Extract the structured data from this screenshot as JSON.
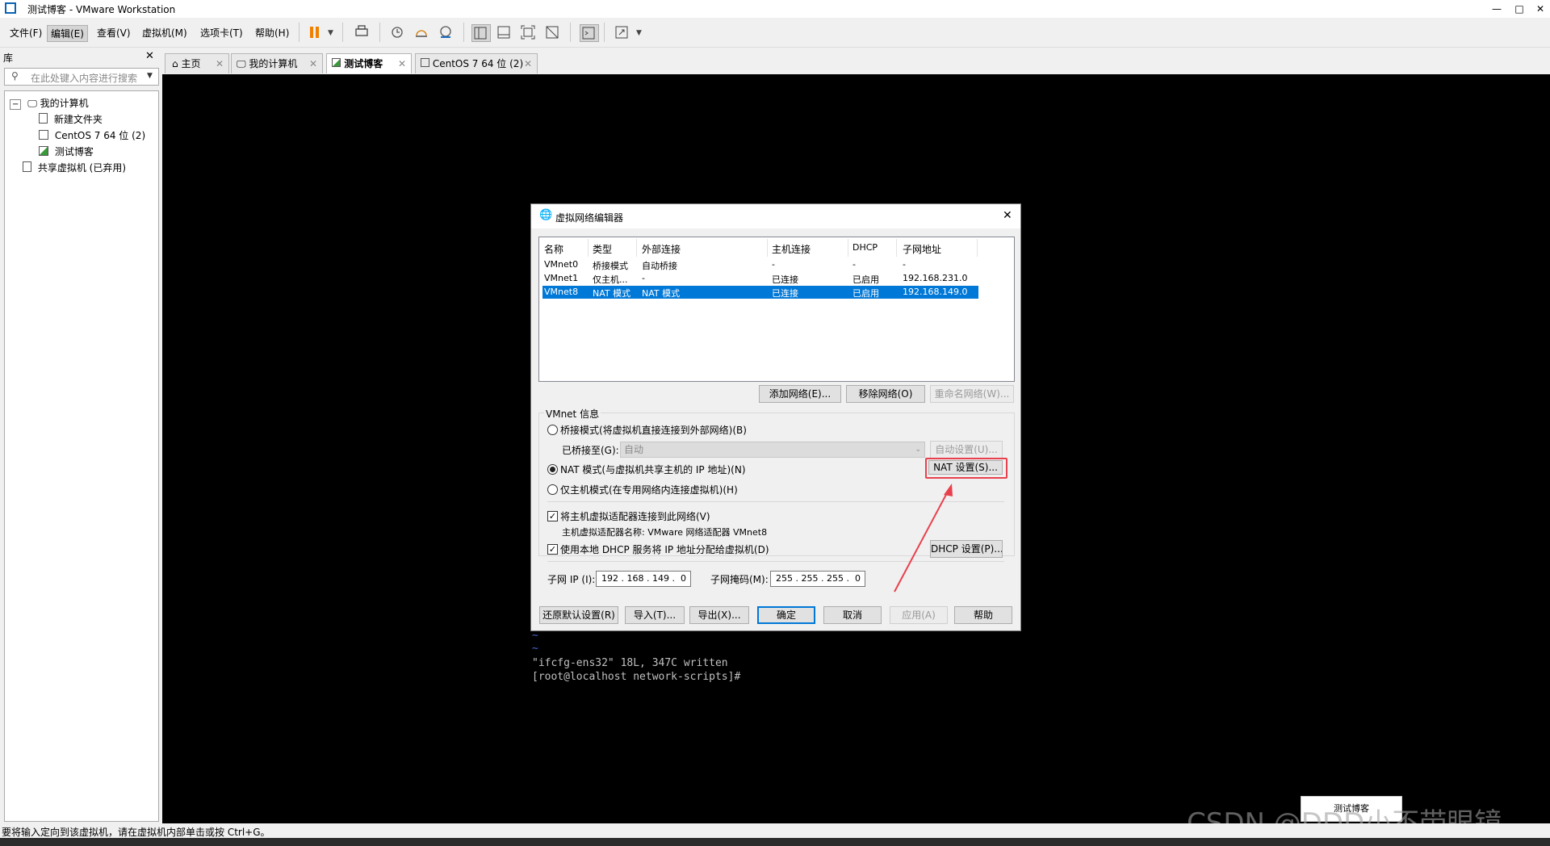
{
  "window": {
    "title": "测试博客 - VMware Workstation"
  },
  "menu": [
    "文件(F)",
    "编辑(E)",
    "查看(V)",
    "虚拟机(M)",
    "选项卡(T)",
    "帮助(H)"
  ],
  "library": {
    "title": "库",
    "search_placeholder": "在此处键入内容进行搜索",
    "tree": [
      "我的计算机",
      "新建文件夹",
      "CentOS 7 64 位 (2)",
      "测试博客",
      "共享虚拟机 (已弃用)"
    ]
  },
  "tabs": [
    "主页",
    "我的计算机",
    "测试博客",
    "CentOS 7 64 位 (2)"
  ],
  "terminal": {
    "tilde": "~",
    "line1": "\"ifcfg-ens32\" 18L, 347C written",
    "line2": "[root@localhost network-scripts]#"
  },
  "status_text": "要将输入定向到该虚拟机，请在虚拟机内部单击或按 Ctrl+G。",
  "thumb_label": "测试博客",
  "watermark": "CSDN @DDD小不带眼镜",
  "dialog": {
    "title": "虚拟网络编辑器",
    "columns": [
      "名称",
      "类型",
      "外部连接",
      "主机连接",
      "DHCP",
      "子网地址"
    ],
    "rows": [
      [
        "VMnet0",
        "桥接模式",
        "自动桥接",
        "-",
        "-",
        "-"
      ],
      [
        "VMnet1",
        "仅主机...",
        "-",
        "已连接",
        "已启用",
        "192.168.231.0"
      ],
      [
        "VMnet8",
        "NAT 模式",
        "NAT 模式",
        "已连接",
        "已启用",
        "192.168.149.0"
      ]
    ],
    "btn_add": "添加网络(E)...",
    "btn_remove": "移除网络(O)",
    "btn_rename": "重命名网络(W)...",
    "group_title": "VMnet 信息",
    "radio_bridge": "桥接模式(将虚拟机直接连接到外部网络)(B)",
    "bridge_to_label": "已桥接至(G):",
    "bridge_to_value": "自动",
    "btn_auto": "自动设置(U)...",
    "radio_nat": "NAT 模式(与虚拟机共享主机的 IP 地址)(N)",
    "btn_nat": "NAT 设置(S)...",
    "radio_host": "仅主机模式(在专用网络内连接虚拟机)(H)",
    "check_adapter": "将主机虚拟适配器连接到此网络(V)",
    "adapter_name": "主机虚拟适配器名称: VMware 网络适配器 VMnet8",
    "check_dhcp": "使用本地 DHCP 服务将 IP 地址分配给虚拟机(D)",
    "btn_dhcp": "DHCP 设置(P)...",
    "subnet_ip_label": "子网 IP (I):",
    "subnet_ip": "192 . 168 . 149 .  0",
    "mask_label": "子网掩码(M):",
    "mask": "255 . 255 . 255 .  0",
    "btn_restore": "还原默认设置(R)",
    "btn_import": "导入(T)...",
    "btn_export": "导出(X)...",
    "btn_ok": "确定",
    "btn_cancel": "取消",
    "btn_apply": "应用(A)",
    "btn_help": "帮助",
    "accent": "#0078d7",
    "highlight": "#e8414d"
  }
}
